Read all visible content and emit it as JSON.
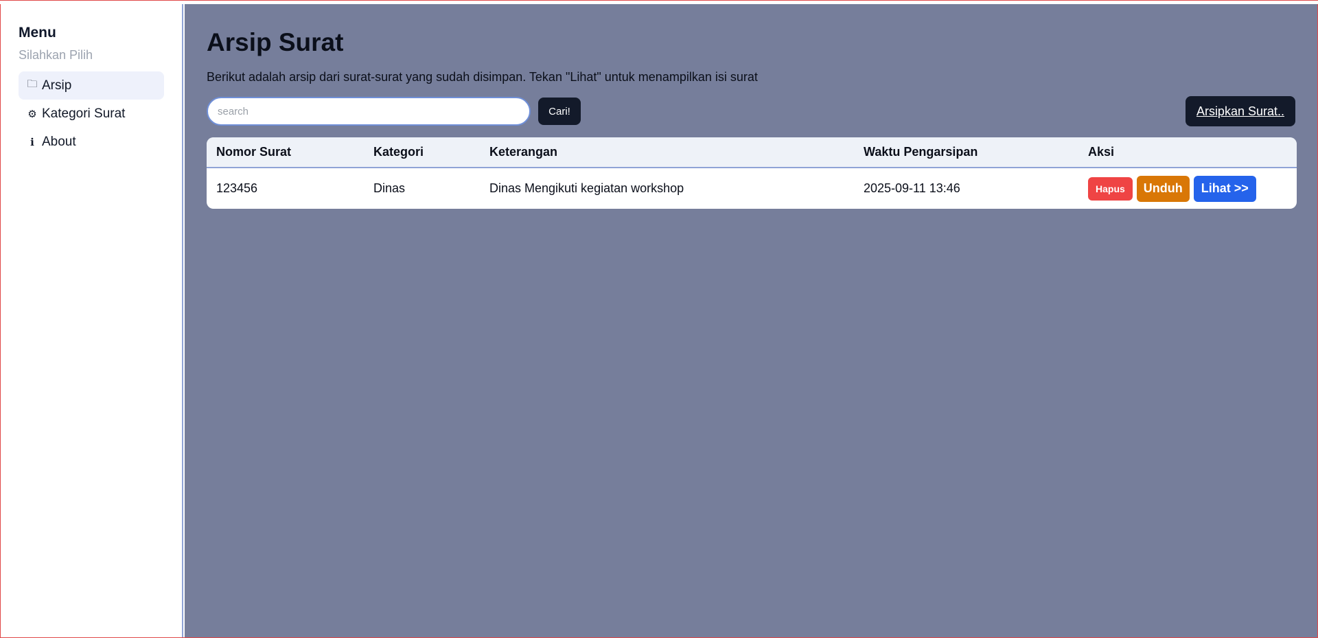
{
  "sidebar": {
    "title": "Menu",
    "subtitle": "Silahkan Pilih",
    "items": [
      {
        "icon": "🗀",
        "label": "Arsip",
        "active": true
      },
      {
        "icon": "⚙",
        "label": "Kategori Surat",
        "active": false
      },
      {
        "icon": "ℹ",
        "label": "About",
        "active": false
      }
    ]
  },
  "main": {
    "title": "Arsip Surat",
    "description": "Berikut adalah arsip dari surat-surat yang sudah disimpan. Tekan \"Lihat\" untuk menampilkan isi surat",
    "search": {
      "placeholder": "search",
      "value": "",
      "button_label": "Cari!"
    },
    "archive_button_label": "Arsipkan Surat..",
    "table": {
      "headers": [
        "Nomor Surat",
        "Kategori",
        "Keterangan",
        "Waktu Pengarsipan",
        "Aksi"
      ],
      "rows": [
        {
          "nomor": "123456",
          "kategori": "Dinas",
          "keterangan": "Dinas Mengikuti kegiatan workshop",
          "waktu": "2025-09-11 13:46",
          "actions": {
            "hapus": "Hapus",
            "unduh": "Unduh",
            "lihat": "Lihat >>"
          }
        }
      ]
    }
  },
  "colors": {
    "main_bg": "#767e9b",
    "dark_button": "#131a2a",
    "hapus": "#ef4444",
    "unduh": "#d97706",
    "lihat": "#2563eb"
  }
}
